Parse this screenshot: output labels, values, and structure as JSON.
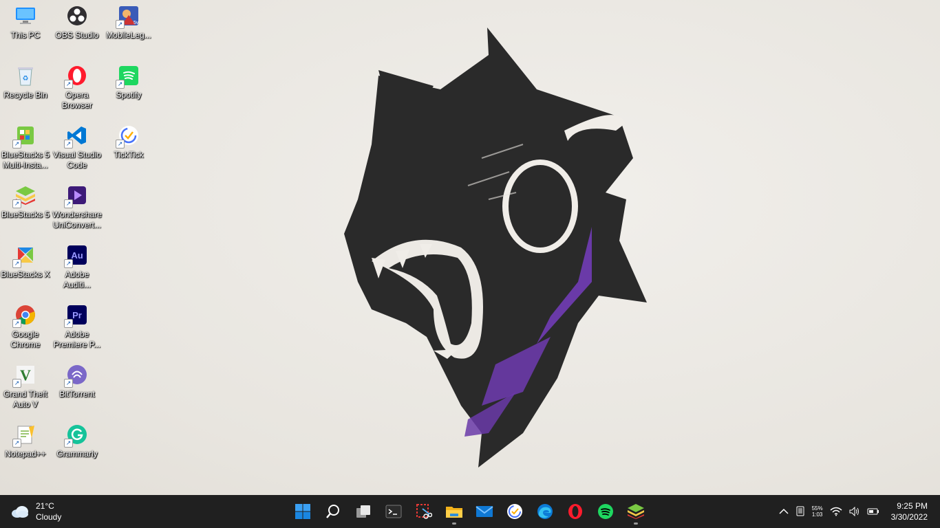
{
  "desktop": {
    "icons": [
      {
        "label": "This PC",
        "icon": "computer-icon"
      },
      {
        "label": "OBS Studio",
        "icon": "obs-icon"
      },
      {
        "label": "MobileLeg...",
        "icon": "mobile-legends-icon"
      },
      {
        "label": "Recycle Bin",
        "icon": "recycle-bin-icon"
      },
      {
        "label": "Opera Browser",
        "icon": "opera-icon"
      },
      {
        "label": "Spotify",
        "icon": "spotify-icon"
      },
      {
        "label": "BlueStacks 5 Multi-Insta...",
        "icon": "bluestacks-multi-icon"
      },
      {
        "label": "Visual Studio Code",
        "icon": "vscode-icon"
      },
      {
        "label": "TickTick",
        "icon": "ticktick-icon"
      },
      {
        "label": "BlueStacks 5",
        "icon": "bluestacks-icon"
      },
      {
        "label": "Wondershare UniConvert...",
        "icon": "uniconverter-icon"
      },
      {
        "label": "BlueStacks X",
        "icon": "bluestacks-x-icon"
      },
      {
        "label": "Adobe Auditi...",
        "icon": "audition-icon"
      },
      {
        "label": "Google Chrome",
        "icon": "chrome-icon"
      },
      {
        "label": "Adobe Premiere P...",
        "icon": "premiere-icon"
      },
      {
        "label": "Grand Theft Auto V",
        "icon": "gta-icon"
      },
      {
        "label": "BitTorrent",
        "icon": "bittorrent-icon"
      },
      {
        "label": "Notepad++",
        "icon": "notepadpp-icon"
      },
      {
        "label": "Grammarly",
        "icon": "grammarly-icon"
      }
    ]
  },
  "taskbar": {
    "weather": {
      "temp": "21°C",
      "condition": "Cloudy",
      "icon": "cloud-icon"
    },
    "apps": [
      {
        "name": "start",
        "icon": "windows-start-icon"
      },
      {
        "name": "search",
        "icon": "search-icon"
      },
      {
        "name": "task-view",
        "icon": "task-view-icon"
      },
      {
        "name": "terminal",
        "icon": "terminal-icon"
      },
      {
        "name": "snipping-tool",
        "icon": "snipping-tool-icon"
      },
      {
        "name": "file-explorer",
        "icon": "folder-icon"
      },
      {
        "name": "mail",
        "icon": "mail-icon"
      },
      {
        "name": "ticktick",
        "icon": "ticktick-icon"
      },
      {
        "name": "edge",
        "icon": "edge-icon"
      },
      {
        "name": "opera",
        "icon": "opera-icon"
      },
      {
        "name": "spotify",
        "icon": "spotify-icon"
      },
      {
        "name": "bluestacks",
        "icon": "bluestacks-icon"
      }
    ],
    "tray": {
      "battery_percent": "55%",
      "battery_time": "1:03",
      "time": "9:25 PM",
      "date": "3/30/2022"
    }
  },
  "colors": {
    "taskbar_bg": "#202020",
    "accent": "#0078d4",
    "wallpaper_purple": "#6a3aa8"
  }
}
